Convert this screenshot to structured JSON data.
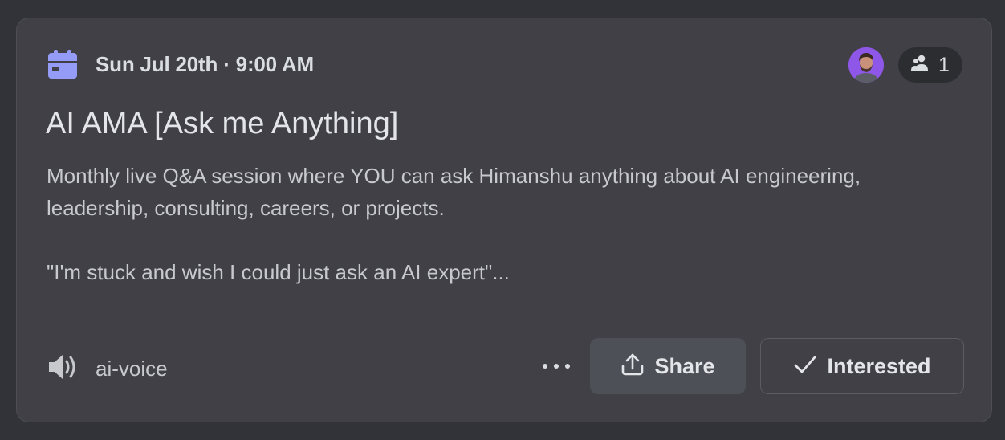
{
  "event": {
    "datetime": "Sun Jul 20th · 9:00 AM",
    "title": "AI AMA [Ask me Anything]",
    "description_line1": "Monthly live Q&A session where YOU can ask Himanshu anything about AI engineering,",
    "description_line2": "leadership, consulting, careers, or projects.",
    "description_quote": "\"I'm stuck and wish I could just ask an AI expert\"...",
    "interested_count": "1",
    "channel": "ai-voice"
  },
  "actions": {
    "more_icon": "ellipsis-icon",
    "share_label": "Share",
    "interested_label": "Interested"
  },
  "icons": {
    "calendar": "calendar-icon",
    "people": "people-icon",
    "speaker": "speaker-icon",
    "share": "share-icon",
    "check": "check-icon"
  },
  "colors": {
    "accent": "#949cf7",
    "avatar_bg": "#8f57e8",
    "card_bg": "#404046",
    "page_bg": "#313338"
  }
}
